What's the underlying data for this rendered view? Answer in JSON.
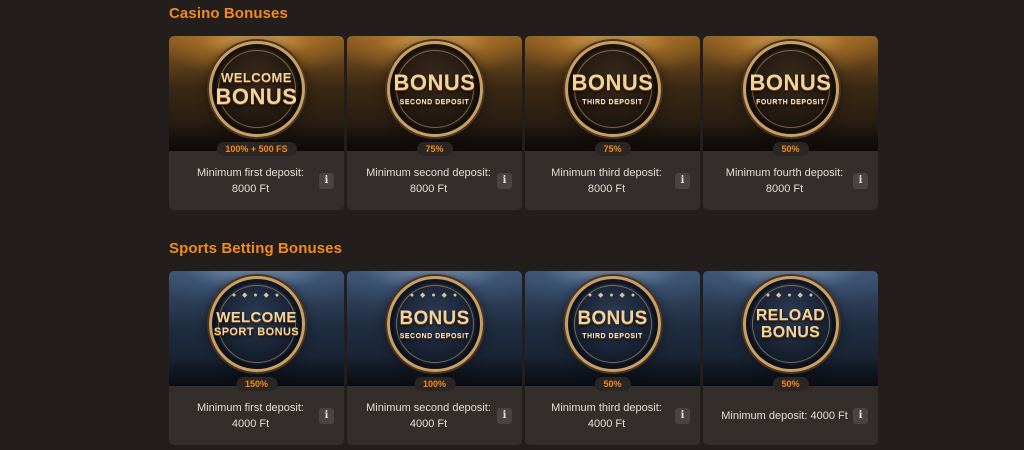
{
  "casino": {
    "title": "Casino Bonuses",
    "cards": [
      {
        "line1": "WELCOME",
        "line2": "BONUS",
        "sub": "",
        "badge": "100% + 500 FS",
        "desc": "Minimum first deposit: 8000 Ft",
        "info": "i"
      },
      {
        "line1": "",
        "line2": "BONUS",
        "sub": "SECOND DEPOSIT",
        "badge": "75%",
        "desc": "Minimum second deposit: 8000 Ft",
        "info": "i"
      },
      {
        "line1": "",
        "line2": "BONUS",
        "sub": "THIRD DEPOSIT",
        "badge": "75%",
        "desc": "Minimum third deposit: 8000 Ft",
        "info": "i"
      },
      {
        "line1": "",
        "line2": "BONUS",
        "sub": "FOURTH DEPOSIT",
        "badge": "50%",
        "desc": "Minimum fourth deposit: 8000 Ft",
        "info": "i"
      }
    ]
  },
  "sports": {
    "title": "Sports Betting Bonuses",
    "cards": [
      {
        "line1": "WELCOME",
        "line2": "SPORT BONUS",
        "sub": "",
        "badge": "150%",
        "desc": "Minimum first deposit: 4000 Ft",
        "info": "i"
      },
      {
        "line1": "",
        "line2": "BONUS",
        "sub": "SECOND DEPOSIT",
        "badge": "100%",
        "desc": "Minimum second deposit: 4000 Ft",
        "info": "i"
      },
      {
        "line1": "",
        "line2": "BONUS",
        "sub": "THIRD DEPOSIT",
        "badge": "50%",
        "desc": "Minimum third deposit: 4000 Ft",
        "info": "i"
      },
      {
        "line1": "RELOAD",
        "line2": "BONUS",
        "sub": "",
        "badge": "50%",
        "desc": "Minimum deposit: 4000 Ft",
        "info": "i"
      }
    ]
  },
  "theme": {
    "accent": "#f28a1c",
    "background": "#231e1c",
    "card": "#332d2b"
  }
}
